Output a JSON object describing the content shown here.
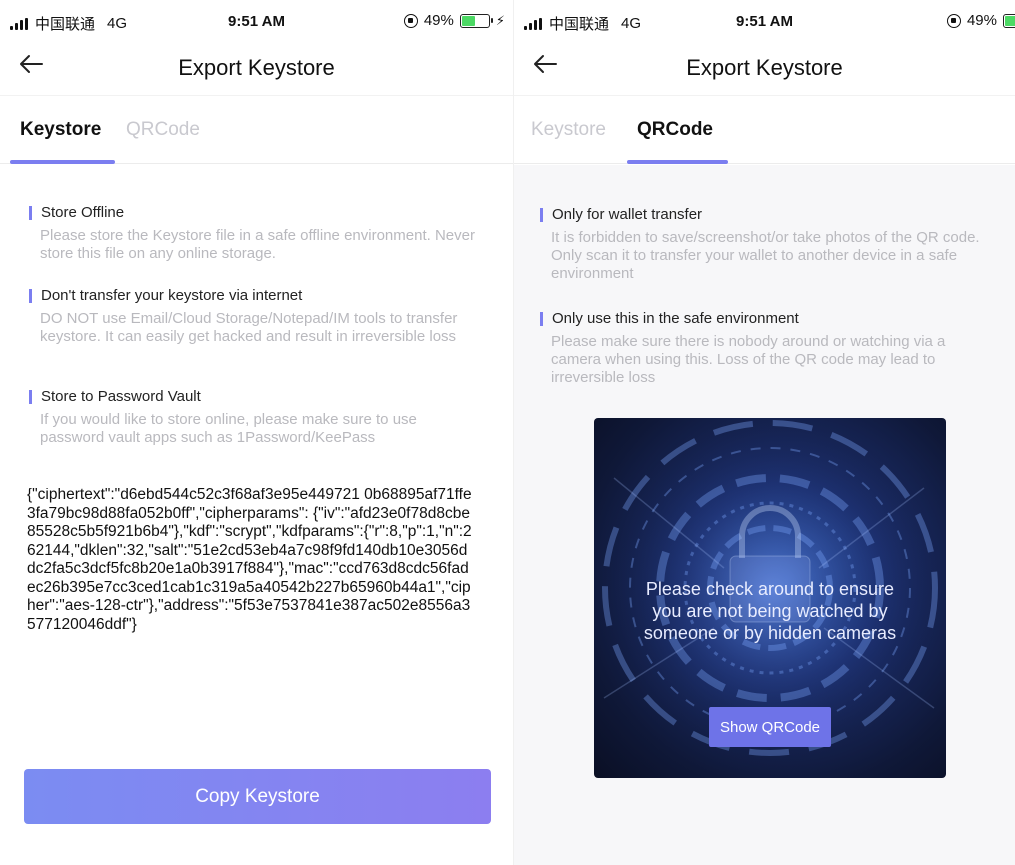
{
  "status_bar": {
    "carrier": "中国联通",
    "network": "4G",
    "time": "9:51 AM",
    "battery_text": "49%",
    "battery_level": 0.49
  },
  "nav": {
    "title": "Export Keystore",
    "back_icon": "arrow-left-icon"
  },
  "tabs": {
    "keystore_label": "Keystore",
    "qrcode_label": "QRCode"
  },
  "left": {
    "active_tab": "Keystore",
    "sections": [
      {
        "title": "Store Offline",
        "desc": "Please store the Keystore file in a safe offline environment. Never store this file on any online storage."
      },
      {
        "title": "Don't transfer your keystore via internet",
        "desc": "DO NOT use Email/Cloud Storage/Notepad/IM tools to transfer keystore. It can easily get hacked and result in irreversible loss"
      },
      {
        "title": "Store to Password Vault",
        "desc": "If you would like to store online, please make sure to use password vault apps such as 1Password/KeePass"
      }
    ],
    "keystore_text": "{\"ciphertext\":\"d6ebd544c52c3f68af3e95e449721 0b68895af71ffe3fa79bc98d88fa052b0ff\",\"cipherparams\": {\"iv\":\"afd23e0f78d8cbe85528c5b5f921b6b4\"},\"kdf\":\"scrypt\",\"kdfparams\":{\"r\":8,\"p\":1,\"n\":262144,\"dklen\":32,\"salt\":\"51e2cd53eb4a7c98f9fd140db10e3056ddc2fa5c3dcf5fc8b20e1a0b3917f884\"},\"mac\":\"ccd763d8cdc56fadec26b395e7cc3ced1cab1c319a5a40542b227b65960b44a1\",\"cipher\":\"aes-128-ctr\"},\"address\":\"5f53e7537841e387ac502e8556a3577120046ddf\"}",
    "copy_button": "Copy Keystore"
  },
  "right": {
    "active_tab": "QRCode",
    "sections": [
      {
        "title": "Only for wallet transfer",
        "desc": "It is forbidden to save/screenshot/or take photos of the QR code. Only scan it to transfer your wallet to another device in a safe environment"
      },
      {
        "title": "Only use this in the safe environment",
        "desc": "Please make sure there is nobody around or watching via a camera when using this. Loss of the QR code may lead to irreversible loss"
      }
    ],
    "qr_card": {
      "warning": "Please check around to ensure you are not being watched by someone or by hidden cameras",
      "button": "Show QRCode",
      "background_icon": "padlock-icon"
    }
  },
  "colors": {
    "accent": "#7b7ef0",
    "inactive_tab": "#c9c9cf",
    "desc_text": "#b9b9be",
    "button_gradient_start": "#7b8cf2",
    "button_gradient_end": "#8c7ef0",
    "qr_button": "#6e73e8",
    "battery_fill": "#4cd964"
  }
}
